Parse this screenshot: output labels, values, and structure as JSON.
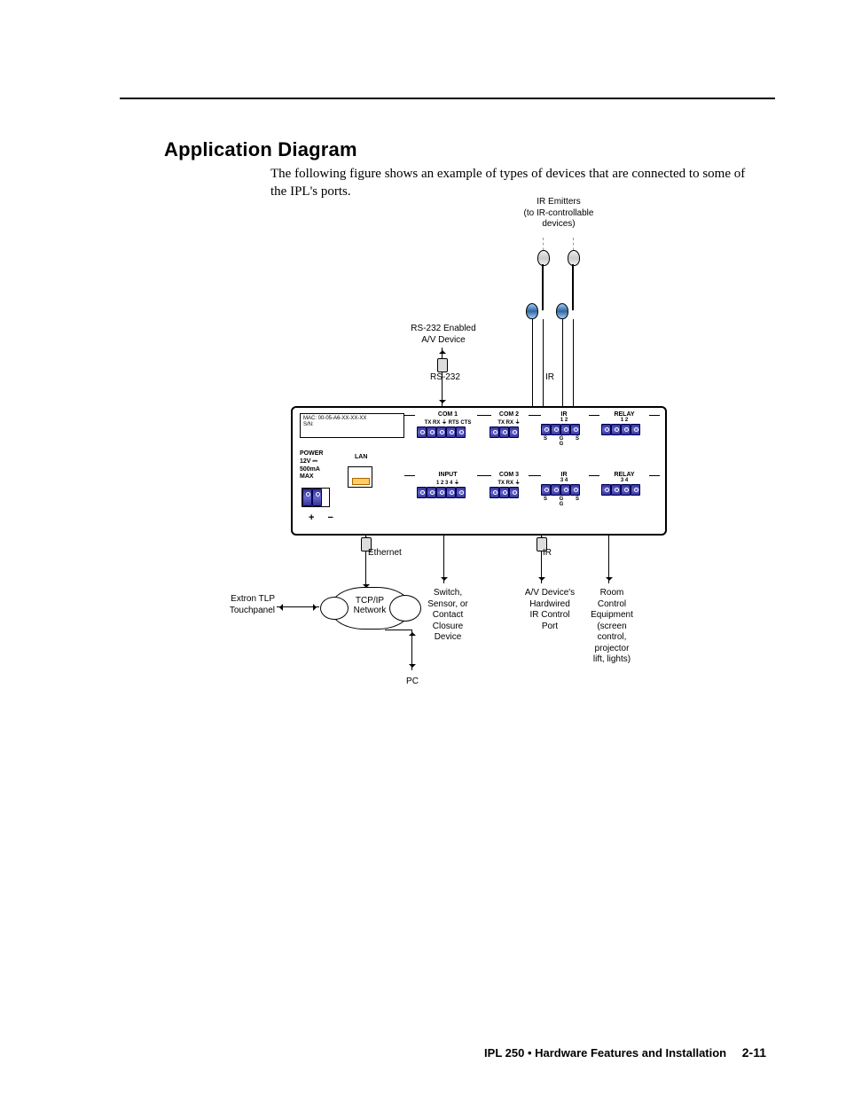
{
  "heading": "Application Diagram",
  "intro": "The following figure shows an example of types of devices that are connected to some of the IPL's ports.",
  "footer": {
    "text": "IPL 250 • Hardware Features and Installation",
    "page": "2-11"
  },
  "diagram": {
    "ir_emitters": "IR Emitters\n(to IR-controllable\ndevices)",
    "rs232_device": "RS-232 Enabled\nA/V Device",
    "rs232": "RS-232",
    "ir": "IR",
    "ethernet": "Ethernet",
    "cloud": "TCP/IP\nNetwork",
    "extron": "Extron TLP\nTouchpanel",
    "switch": "Switch,\nSensor, or\nContact\nClosure\nDevice",
    "av_device": "A/V Device's\nHardwired\nIR Control\nPort",
    "room": "Room\nControl\nEquipment\n(screen\ncontrol,\nprojector\nlift, lights)",
    "pc": "PC",
    "panel": {
      "mac": "MAC: 00-05-A6-XX-XX-XX",
      "sn": "S/N:",
      "power": "POWER\n12V ⎓\n500mA\nMAX",
      "lan": "LAN",
      "plusminus": "+ −",
      "com1": {
        "title": "COM 1",
        "pins": "TX RX ⏚ RTS CTS"
      },
      "com2": {
        "title": "COM 2",
        "pins": "TX RX ⏚"
      },
      "com3": {
        "title": "COM 3",
        "pins": "TX RX ⏚"
      },
      "ir12": {
        "title": "IR",
        "pins_top": "1   2"
      },
      "ir34": {
        "title": "IR",
        "pins_top": "3   4"
      },
      "relay12": {
        "title": "RELAY",
        "pins_top": "1   2"
      },
      "relay34": {
        "title": "RELAY",
        "pins_top": "3   4"
      },
      "input": {
        "title": "INPUT",
        "pins": "1  2  3  4  ⏚"
      },
      "sgsg": "S  G  S  G"
    }
  }
}
